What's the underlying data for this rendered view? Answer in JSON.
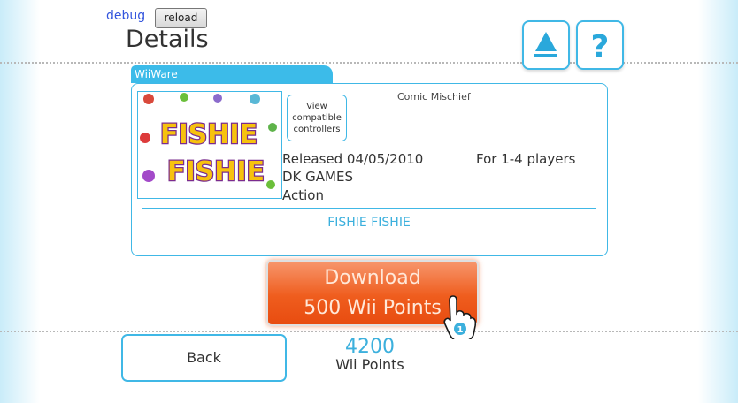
{
  "header": {
    "debug_label": "debug",
    "reload_label": "reload",
    "title": "Details"
  },
  "toolbar": {
    "up_icon": "eject-up-arrow-icon",
    "help_icon": "question-mark-icon",
    "help_glyph": "?"
  },
  "title_card": {
    "category_tab": "WiiWare",
    "view_controllers_label": "View compatible controllers",
    "rating_descriptor": "Comic Mischief",
    "released": "Released 04/05/2010",
    "players": "For 1-4 players",
    "publisher": "DK GAMES",
    "genre": "Action",
    "game_name": "FISHIE FISHIE",
    "logo_line1": "FISHIE",
    "logo_line2": "FISHIE"
  },
  "purchase": {
    "download_label": "Download",
    "price_label": "500 Wii Points"
  },
  "cursor": {
    "player_number": "1"
  },
  "footer": {
    "back_label": "Back",
    "points_value": "4200",
    "points_unit": "Wii Points"
  },
  "colors": {
    "accent": "#40b8e6",
    "download": "#ef5d1e",
    "text": "#333333"
  }
}
